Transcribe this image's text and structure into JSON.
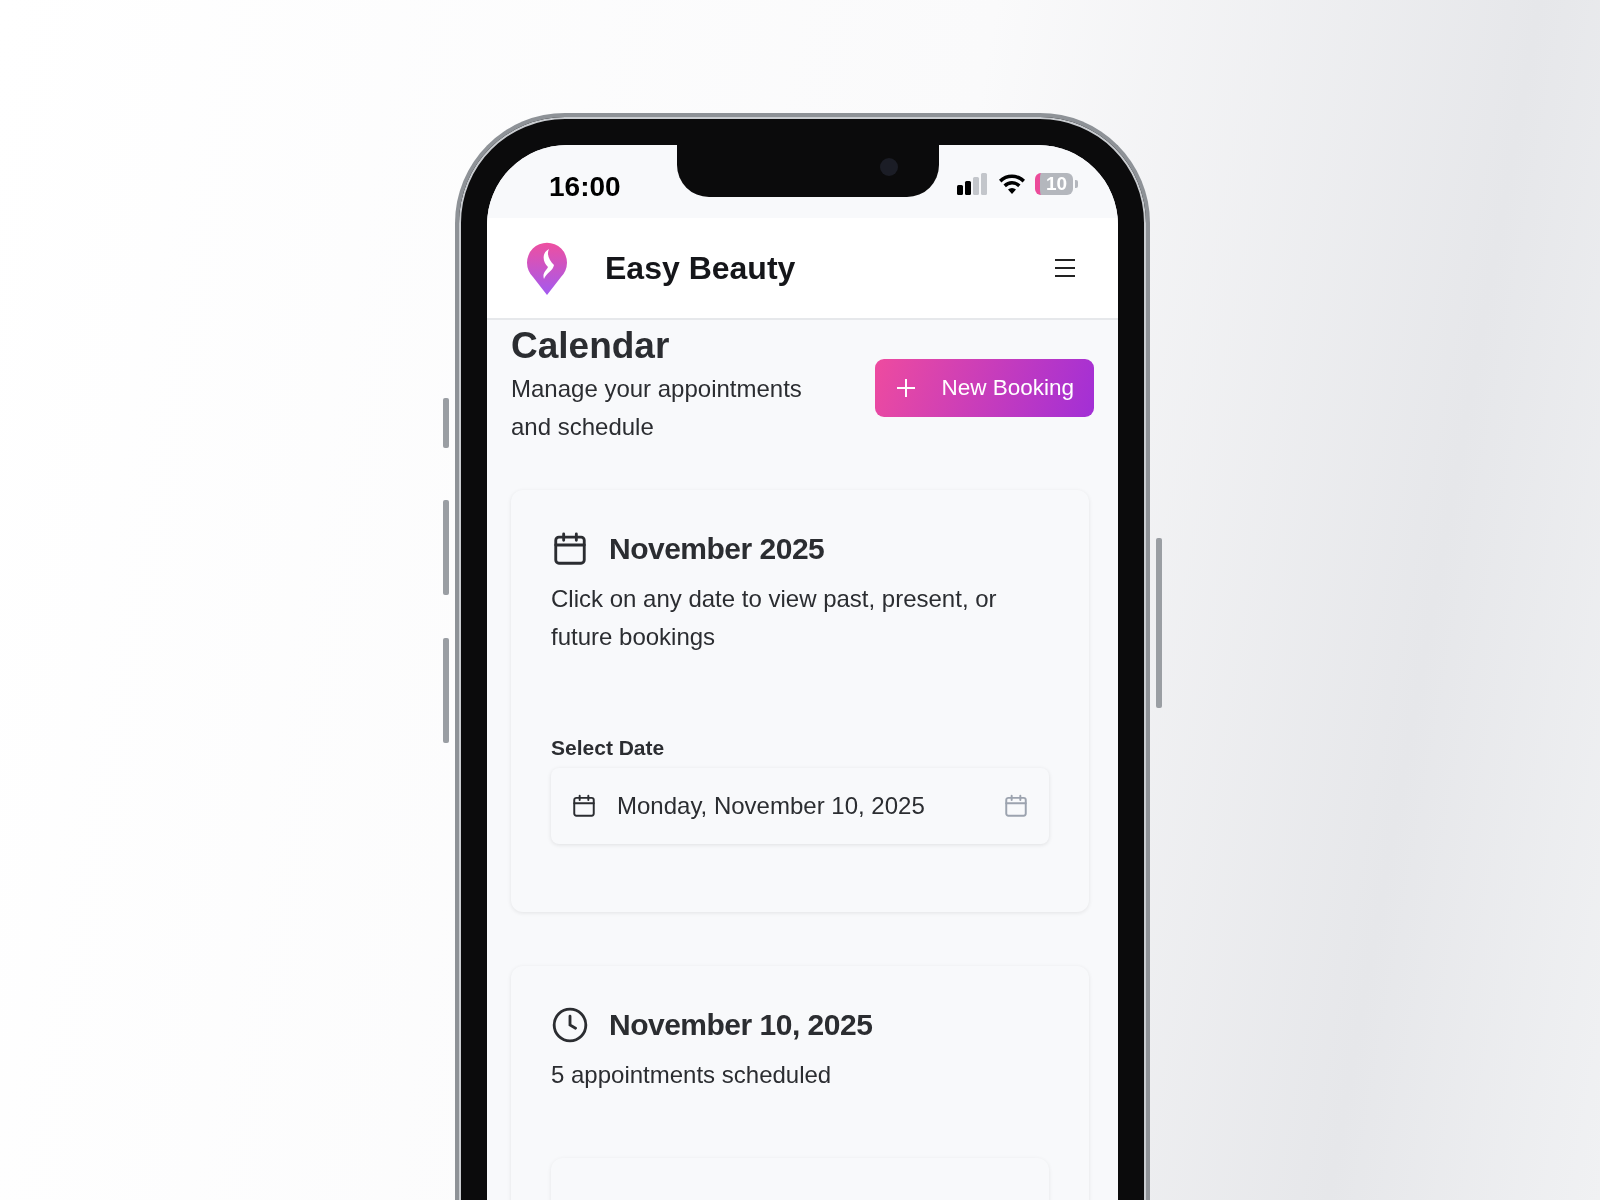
{
  "status_bar": {
    "time": "16:00",
    "battery": "10"
  },
  "header": {
    "title": "Easy Beauty"
  },
  "page": {
    "title": "Calendar",
    "subtitle": "Manage your appointments and schedule",
    "new_button": "New Booking"
  },
  "month_card": {
    "title": "November 2025",
    "description": "Click on any date to view past, present, or future bookings",
    "date_label": "Select Date",
    "date_value": "Monday, November 10, 2025"
  },
  "day_card": {
    "title": "November 10, 2025",
    "summary": "5 appointments scheduled"
  }
}
